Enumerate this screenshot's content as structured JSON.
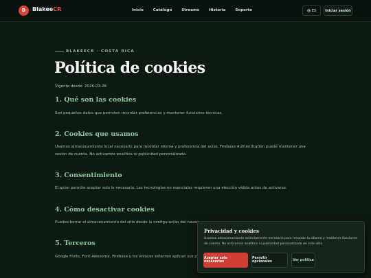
{
  "header": {
    "logo_initial": "B",
    "logo_name": "Blakee",
    "logo_accent": "CR",
    "nav": [
      "Inicio",
      "Catálogo",
      "Streams",
      "Historia",
      "Soporte"
    ],
    "language_label": "ES",
    "language_icon": "globe-icon",
    "login_label": "Iniciar sesión"
  },
  "page": {
    "eyebrow": "BLAKEECR · COSTA RICA",
    "title": "Política de cookies",
    "effective": "Vigente desde: 2026-03-26"
  },
  "sections": [
    {
      "heading": "1. Qué son las cookies",
      "body": "Son pequeños datos que permiten recordar preferencias y mantener funciones técnicas."
    },
    {
      "heading": "2. Cookies que usamos",
      "body": "Usamos almacenamiento local necesario para recordar idioma y preferencia del aviso. Firebase Authentication puede mantener una sesión de cuenta. No activamos analítica ni publicidad personalizada."
    },
    {
      "heading": "3. Consentimiento",
      "body": "El aviso permite aceptar solo lo necesario. Las tecnologías no esenciales requieren una elección válida antes de activarse."
    },
    {
      "heading": "4. Cómo desactivar cookies",
      "body": "Puedes borrar el almacenamiento del sitio desde la configuración del naveg"
    },
    {
      "heading": "5. Terceros",
      "body": "Google Fonts, Font Awesome, Firebase y los enlaces externos aplican sus p"
    }
  ],
  "cookie_banner": {
    "title": "Privacidad y cookies",
    "text": "Usamos almacenamiento estrictamente necesario para recordar tu idioma y mantener funciones de cuenta. No activamos analítica ni publicidad personalizada en este sitio.",
    "accept_label": "Aceptar solo necesarias",
    "options_label": "Permitir opcionales",
    "policy_label": "Ver política"
  },
  "colors": {
    "background": "#0d1a12",
    "accent_red": "#cf3f35",
    "heading_green": "#8cc79e"
  }
}
